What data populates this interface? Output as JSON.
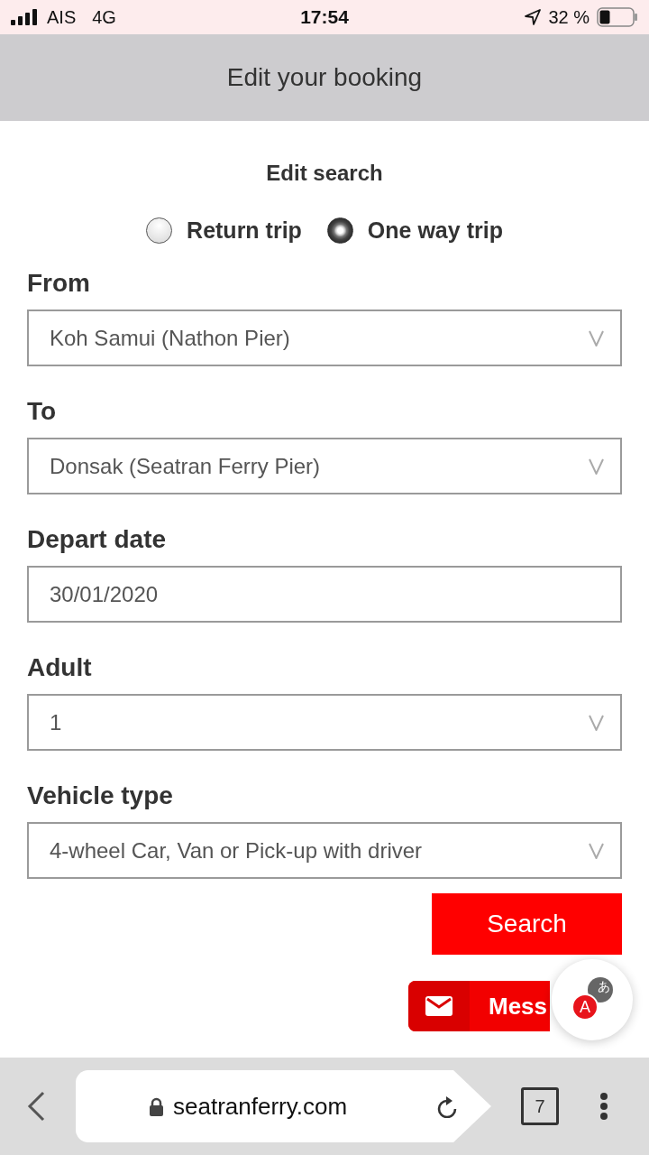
{
  "status_bar": {
    "carrier": "AIS",
    "network": "4G",
    "time": "17:54",
    "battery": "32 %"
  },
  "header": {
    "title": "Edit your booking"
  },
  "form": {
    "title": "Edit search",
    "trip_types": [
      {
        "label": "Return trip",
        "selected": false
      },
      {
        "label": "One way trip",
        "selected": true
      }
    ],
    "fields": [
      {
        "label": "From",
        "kind": "select",
        "value": "Koh Samui (Nathon Pier)"
      },
      {
        "label": "To",
        "kind": "select",
        "value": "Donsak (Seatran Ferry Pier)"
      },
      {
        "label": "Depart date",
        "kind": "input",
        "value": "30/01/2020"
      },
      {
        "label": "Adult",
        "kind": "select",
        "value": "1"
      },
      {
        "label": "Vehicle type",
        "kind": "select",
        "value": "4-wheel Car, Van or Pick-up with driver"
      }
    ],
    "search_button": "Search"
  },
  "message_button": {
    "label": "Mess"
  },
  "translate_button": {
    "letter": "A",
    "script": "あ"
  },
  "browser_bar": {
    "url": "seatranferry.com",
    "tab_count": "7"
  }
}
